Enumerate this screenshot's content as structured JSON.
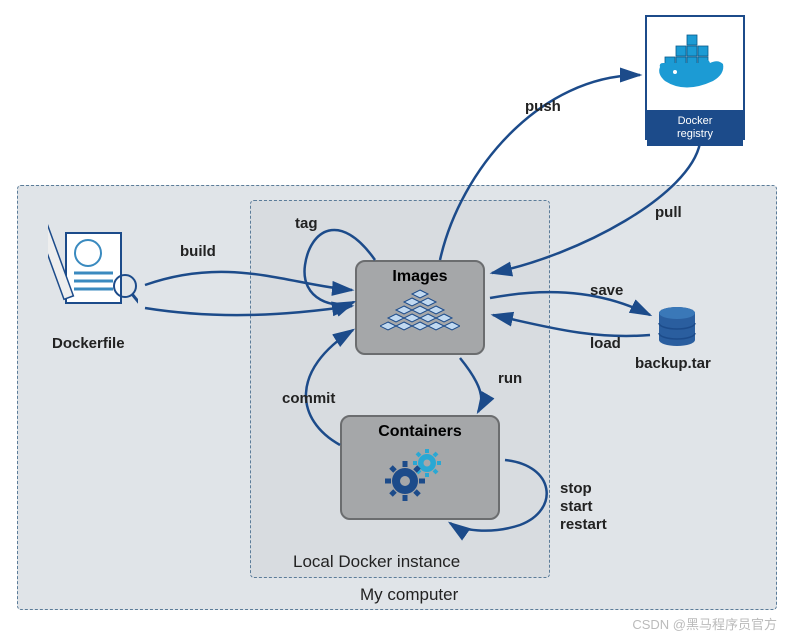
{
  "outerContainer": {
    "label": "My computer"
  },
  "innerContainer": {
    "label": "Local Docker instance"
  },
  "nodes": {
    "dockerfile": {
      "label": "Dockerfile"
    },
    "images": {
      "label": "Images"
    },
    "containers": {
      "label": "Containers"
    },
    "registry": {
      "label1": "Docker",
      "label2": "registry"
    },
    "backup": {
      "label": "backup.tar"
    }
  },
  "arrows": {
    "build": "build",
    "tag": "tag",
    "push": "push",
    "pull": "pull",
    "save": "save",
    "load": "load",
    "run": "run",
    "commit": "commit",
    "stop": "stop",
    "start": "start",
    "restart": "restart"
  },
  "watermark": "CSDN @黑马程序员官方"
}
